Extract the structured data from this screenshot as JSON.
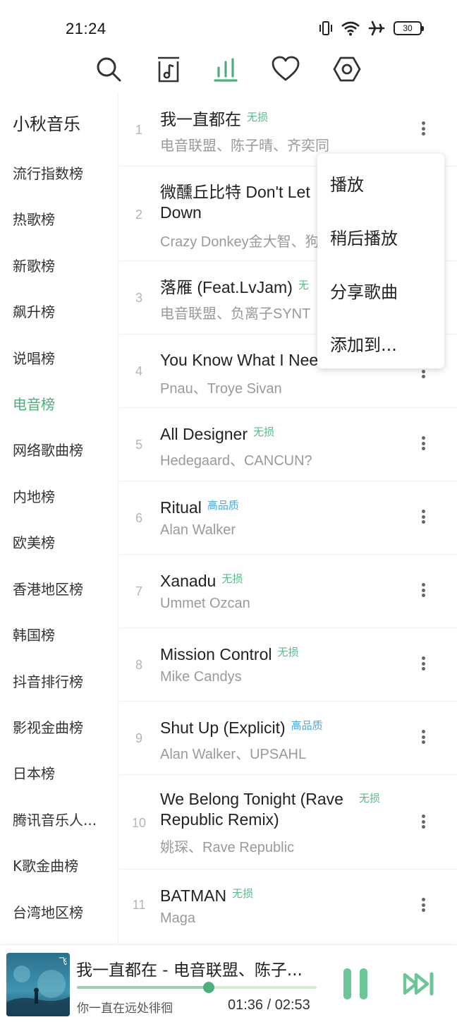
{
  "status": {
    "time": "21:24",
    "battery": "30"
  },
  "nav": {
    "icons": [
      "search-icon",
      "music-library-icon",
      "chart-bars-icon",
      "heart-icon",
      "settings-hexagon-icon"
    ],
    "active_color": "#4caf7d"
  },
  "sidebar": {
    "title": "小秋音乐",
    "items": [
      {
        "label": "流行指数榜"
      },
      {
        "label": "热歌榜"
      },
      {
        "label": "新歌榜"
      },
      {
        "label": "飙升榜"
      },
      {
        "label": "说唱榜"
      },
      {
        "label": "电音榜",
        "active": true
      },
      {
        "label": "网络歌曲榜"
      },
      {
        "label": "内地榜"
      },
      {
        "label": "欧美榜"
      },
      {
        "label": "香港地区榜"
      },
      {
        "label": "韩国榜"
      },
      {
        "label": "抖音排行榜"
      },
      {
        "label": "影视金曲榜"
      },
      {
        "label": "日本榜"
      },
      {
        "label": "腾讯音乐人..."
      },
      {
        "label": "K歌金曲榜"
      },
      {
        "label": "台湾地区榜"
      }
    ]
  },
  "songs": [
    {
      "index": "1",
      "title": "我一直都在",
      "quality": "无损",
      "artist": "电音联盟、陈子晴、齐奕同"
    },
    {
      "index": "2",
      "title_line1": "微醺丘比特 Don't Let",
      "title_line2": "Down",
      "artist": "Crazy Donkey金大智、狗"
    },
    {
      "index": "3",
      "title": "落雁 (Feat.LvJam)",
      "quality": "无",
      "artist": "电音联盟、负离子SYNT"
    },
    {
      "index": "4",
      "title": "You Know What I Nee",
      "artist": "Pnau、Troye Sivan"
    },
    {
      "index": "5",
      "title": "All Designer",
      "quality": "无损",
      "artist": "Hedegaard、CANCUN?"
    },
    {
      "index": "6",
      "title": "Ritual",
      "quality": "高品质",
      "artist": "Alan Walker"
    },
    {
      "index": "7",
      "title": "Xanadu",
      "quality": "无损",
      "artist": "Ummet Ozcan"
    },
    {
      "index": "8",
      "title": "Mission Control",
      "quality": "无损",
      "artist": "Mike Candys"
    },
    {
      "index": "9",
      "title": "Shut Up (Explicit)",
      "quality": "高品质",
      "artist": "Alan Walker、UPSAHL"
    },
    {
      "index": "10",
      "title_line1": "We Belong Tonight (Rave",
      "title_line2": "Republic Remix)",
      "quality": "无损",
      "artist": "姚琛、Rave Republic"
    },
    {
      "index": "11",
      "title": "BATMAN",
      "quality": "无损",
      "artist": "Maga"
    }
  ],
  "context_menu": {
    "items": [
      "播放",
      "稍后播放",
      "分享歌曲",
      "添加到..."
    ]
  },
  "player": {
    "title": "我一直都在 - 电音联盟、陈子...",
    "lyric": "你一直在远处徘徊",
    "time": "01:36 / 02:53",
    "progress": 0.55,
    "album_art_text": "飞"
  }
}
